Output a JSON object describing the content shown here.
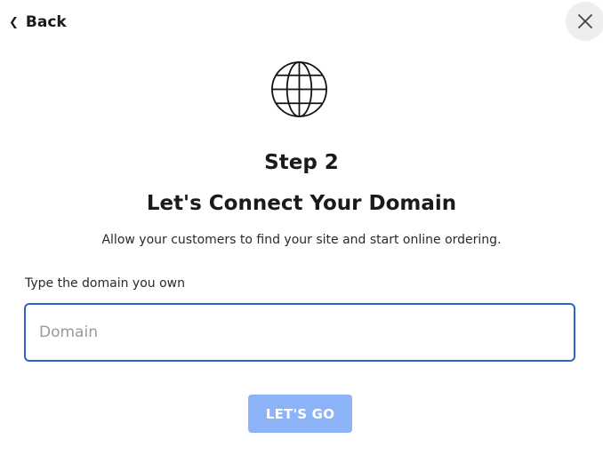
{
  "header": {
    "back_label": "Back",
    "back_icon": "chevron-left-icon",
    "close_icon": "close-icon"
  },
  "hero": {
    "icon": "globe-icon",
    "step_label": "Step 2",
    "title": "Let's Connect Your Domain",
    "subtitle": "Allow your customers to find your site and start online ordering."
  },
  "form": {
    "domain_label": "Type the domain you own",
    "domain_placeholder": "Domain",
    "domain_value": "",
    "submit_label": "LET'S GO"
  },
  "colors": {
    "input_border": "#2f62c8",
    "button_bg": "#8cb3f8",
    "close_bg": "#eeeeee"
  }
}
